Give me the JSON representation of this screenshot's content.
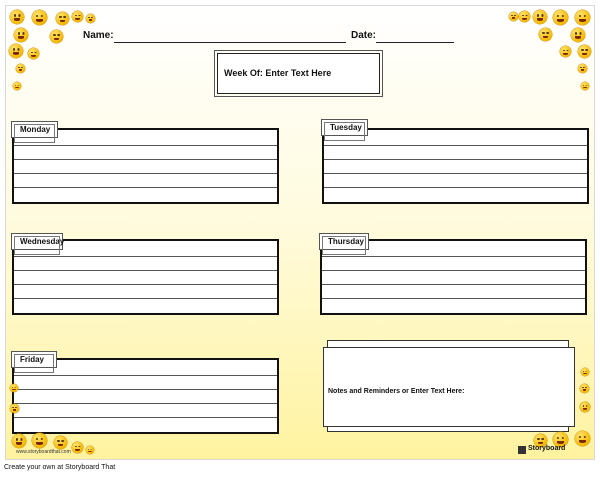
{
  "header": {
    "name_label": "Name:",
    "date_label": "Date:"
  },
  "week": {
    "label": "Week Of: Enter Text Here"
  },
  "days": {
    "monday": "Monday",
    "tuesday": "Tuesday",
    "wednesday": "Wednesday",
    "thursday": "Thursday",
    "friday": "Friday"
  },
  "notes": {
    "label": "Notes and Reminders or Enter Text Here:"
  },
  "watermark": {
    "left": "www.storyboardthat.com",
    "right": "Storyboard"
  },
  "footer": {
    "text": "Create your own at Storyboard That"
  },
  "colors": {
    "emoji": "#f5b800",
    "background_top": "#ffffff",
    "background_bottom": "#fff3a0"
  },
  "icons": {
    "decor": "smiley-emoji-icon",
    "logo": "storyboardthat-logo-icon"
  }
}
